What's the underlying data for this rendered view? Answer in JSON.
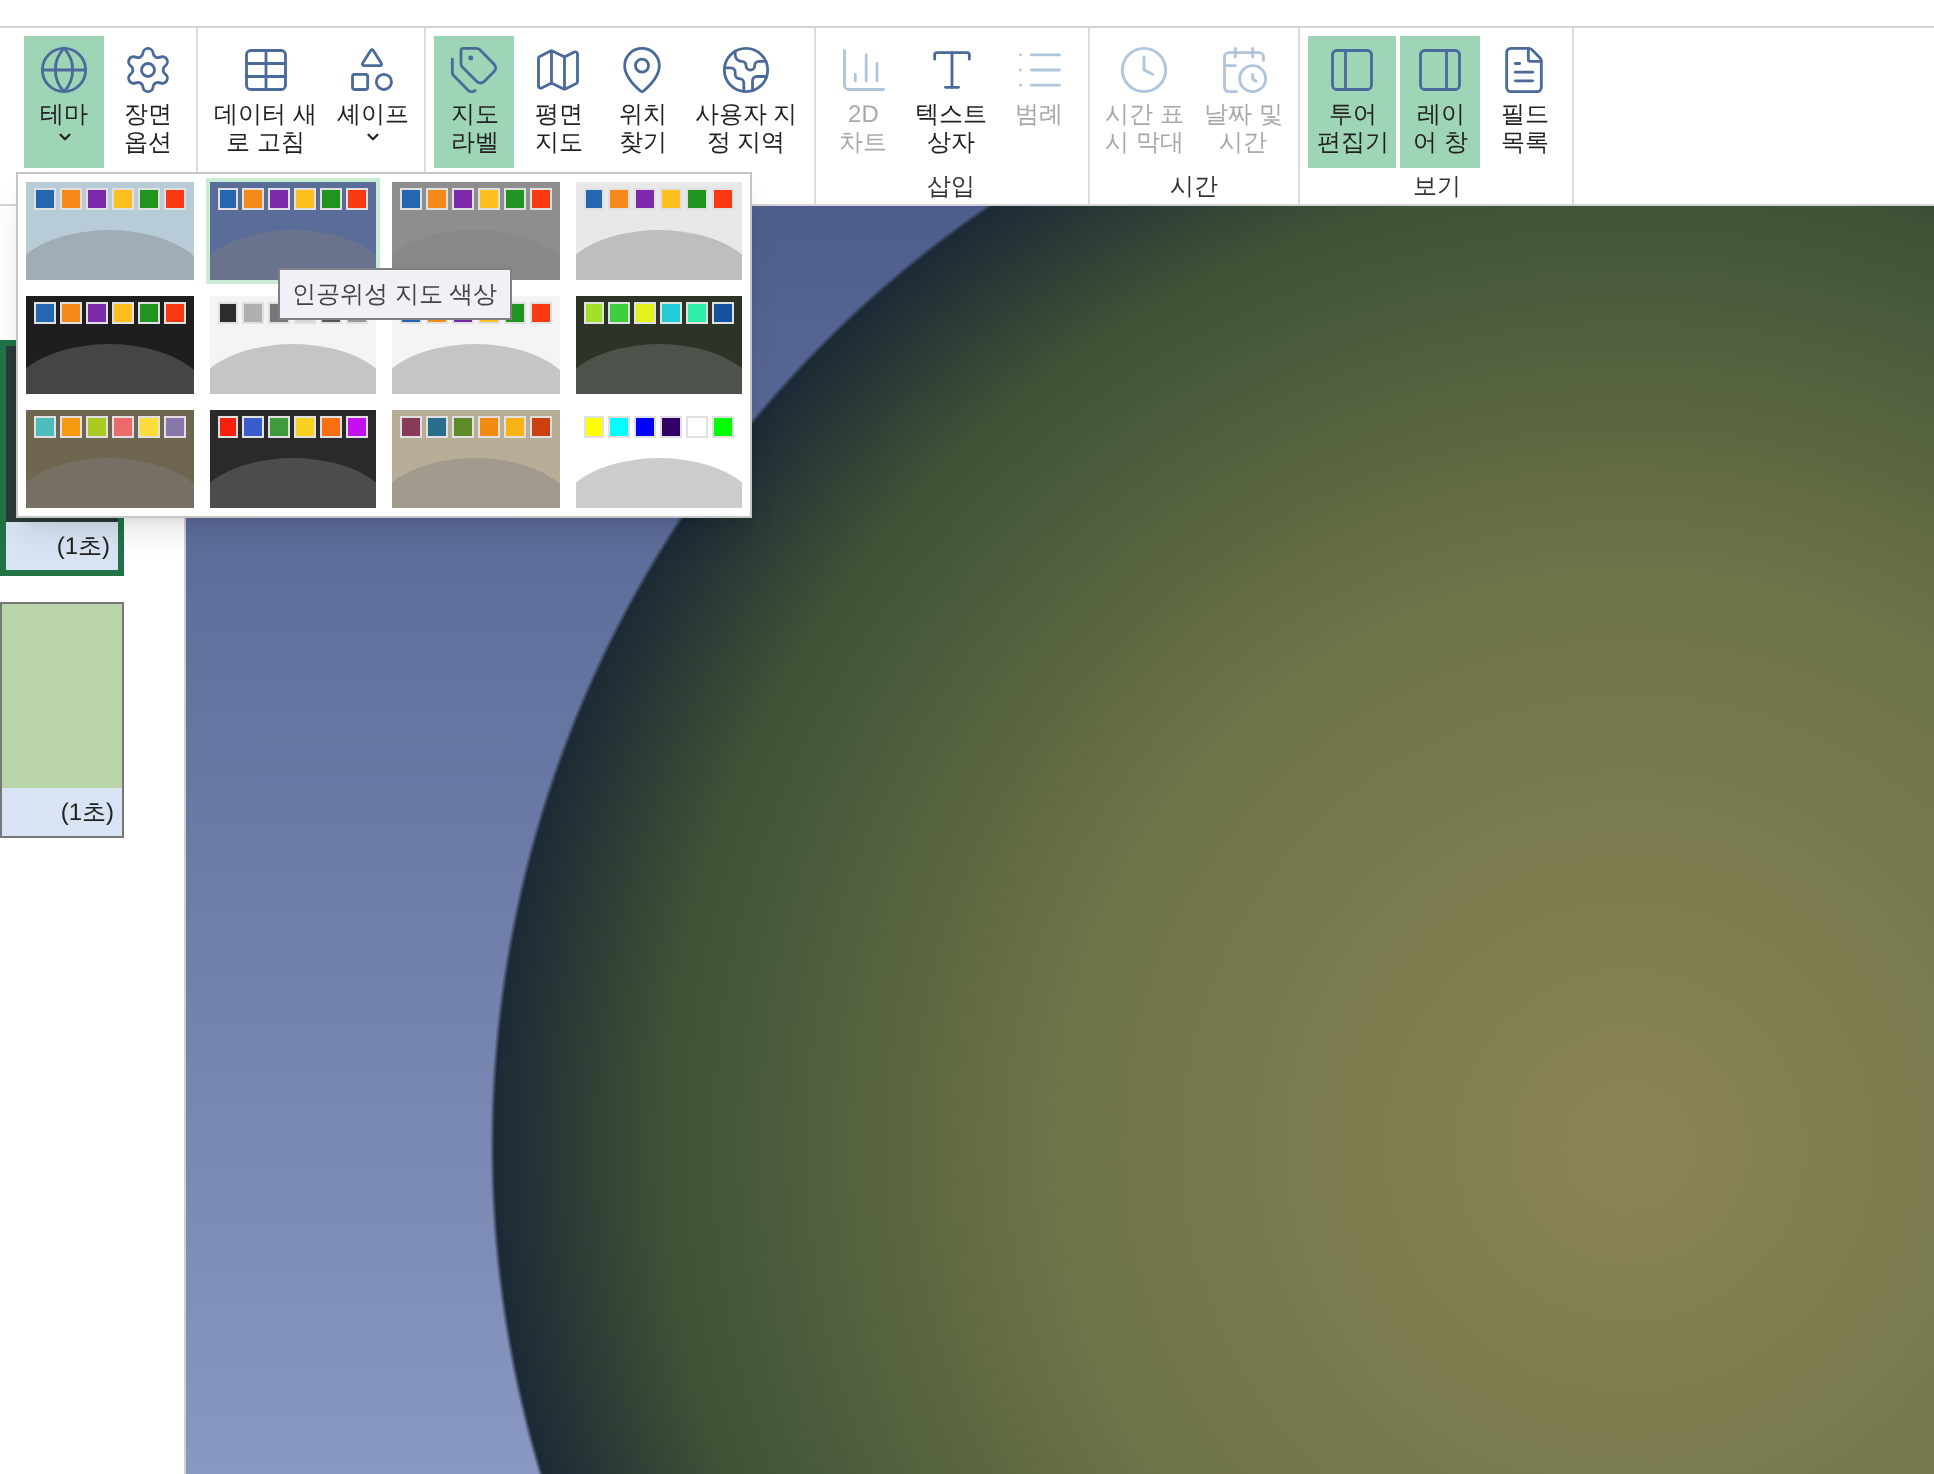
{
  "ribbon": {
    "groups": [
      {
        "buttons": [
          {
            "lines": [
              "테마"
            ],
            "on": true,
            "dropdown": true,
            "disabled": false
          },
          {
            "lines": [
              "장면",
              "옵션"
            ],
            "on": false,
            "dropdown": false,
            "disabled": false
          }
        ]
      },
      {
        "buttons": [
          {
            "lines": [
              "데이터 새",
              "로 고침"
            ],
            "on": false,
            "dropdown": false,
            "disabled": false
          },
          {
            "lines": [
              "셰이프"
            ],
            "on": false,
            "dropdown": true,
            "disabled": false
          }
        ]
      },
      {
        "buttons": [
          {
            "lines": [
              "지도",
              "라벨"
            ],
            "on": true,
            "dropdown": false,
            "disabled": false
          },
          {
            "lines": [
              "평면",
              "지도"
            ],
            "on": false,
            "dropdown": false,
            "disabled": false
          },
          {
            "lines": [
              "위치",
              "찾기"
            ],
            "on": false,
            "dropdown": false,
            "disabled": false
          },
          {
            "lines": [
              "사용자 지",
              "정 지역"
            ],
            "on": false,
            "dropdown": false,
            "disabled": false
          }
        ]
      },
      {
        "label": "삽입",
        "buttons": [
          {
            "lines": [
              "2D",
              "차트"
            ],
            "on": false,
            "dropdown": false,
            "disabled": true
          },
          {
            "lines": [
              "텍스트",
              "상자"
            ],
            "on": false,
            "dropdown": false,
            "disabled": false
          },
          {
            "lines": [
              "범례"
            ],
            "on": false,
            "dropdown": false,
            "disabled": true
          }
        ]
      },
      {
        "label": "시간",
        "buttons": [
          {
            "lines": [
              "시간 표",
              "시 막대"
            ],
            "on": false,
            "dropdown": false,
            "disabled": true
          },
          {
            "lines": [
              "날짜 및",
              "시간"
            ],
            "on": false,
            "dropdown": false,
            "disabled": true
          }
        ]
      },
      {
        "label": "보기",
        "buttons": [
          {
            "lines": [
              "투어",
              "편집기"
            ],
            "on": true,
            "dropdown": false,
            "disabled": false
          },
          {
            "lines": [
              "레이",
              "어 창"
            ],
            "on": true,
            "dropdown": false,
            "disabled": false
          },
          {
            "lines": [
              "필드",
              "목록"
            ],
            "on": false,
            "dropdown": false,
            "disabled": false
          }
        ]
      }
    ]
  },
  "theme_gallery": {
    "tooltip": "인공위성 지도 색상",
    "themes": [
      {
        "selected": false,
        "color": "#b8ccd8",
        "swatches": [
          {
            "color": "#2466b0"
          },
          {
            "color": "#f5891a"
          },
          {
            "color": "#7b2aab"
          },
          {
            "color": "#fdbf1e"
          },
          {
            "color": "#219321"
          },
          {
            "color": "#fb3a14"
          }
        ]
      },
      {
        "selected": true,
        "color": "#5a6c98",
        "swatches": [
          {
            "color": "#2466b0"
          },
          {
            "color": "#f5891a"
          },
          {
            "color": "#7b2aab"
          },
          {
            "color": "#fdbf1e"
          },
          {
            "color": "#219321"
          },
          {
            "color": "#fb3a14"
          }
        ]
      },
      {
        "selected": false,
        "color": "#8e8e8e",
        "swatches": [
          {
            "color": "#2466b0"
          },
          {
            "color": "#f5891a"
          },
          {
            "color": "#7b2aab"
          },
          {
            "color": "#fdbf1e"
          },
          {
            "color": "#219321"
          },
          {
            "color": "#fb3a14"
          }
        ]
      },
      {
        "selected": false,
        "color": "#e8e8e8",
        "swatches": [
          {
            "color": "#2466b0"
          },
          {
            "color": "#f5891a"
          },
          {
            "color": "#7b2aab"
          },
          {
            "color": "#fdbf1e"
          },
          {
            "color": "#219321"
          },
          {
            "color": "#fb3a14"
          }
        ]
      },
      {
        "selected": false,
        "color": "#1e1e1e",
        "swatches": [
          {
            "color": "#2466b0"
          },
          {
            "color": "#f5891a"
          },
          {
            "color": "#7b2aab"
          },
          {
            "color": "#fdbf1e"
          },
          {
            "color": "#219321"
          },
          {
            "color": "#fb3a14"
          }
        ]
      },
      {
        "selected": false,
        "color": "#f4f4f4",
        "swatches": [
          {
            "color": "#2c2c2c"
          },
          {
            "color": "#b0b0b0"
          },
          {
            "color": "#777777"
          },
          {
            "color": "#d4d4d4"
          },
          {
            "color": "#555555"
          },
          {
            "color": "#999999"
          }
        ]
      },
      {
        "selected": false,
        "color": "#f4f4f4",
        "swatches": [
          {
            "color": "#2466b0"
          },
          {
            "color": "#f5891a"
          },
          {
            "color": "#7b2aab"
          },
          {
            "color": "#fdbf1e"
          },
          {
            "color": "#219321"
          },
          {
            "color": "#fb3a14"
          }
        ]
      },
      {
        "selected": false,
        "color": "#2c3428",
        "swatches": [
          {
            "color": "#a2e02a"
          },
          {
            "color": "#3ecf3e"
          },
          {
            "color": "#e4f21c"
          },
          {
            "color": "#22ccd6"
          },
          {
            "color": "#2ef0a8"
          },
          {
            "color": "#1650a0"
          }
        ]
      },
      {
        "selected": false,
        "color": "#6e6650",
        "swatches": [
          {
            "color": "#4cbcbc"
          },
          {
            "color": "#f89a10"
          },
          {
            "color": "#aacc22"
          },
          {
            "color": "#ec6a6a"
          },
          {
            "color": "#fedc3a"
          },
          {
            "color": "#8877aa"
          }
        ]
      },
      {
        "selected": false,
        "color": "#2a2a2a",
        "swatches": [
          {
            "color": "#fa2010"
          },
          {
            "color": "#3a5ccc"
          },
          {
            "color": "#3e9a3e"
          },
          {
            "color": "#f8d020"
          },
          {
            "color": "#fa7010"
          },
          {
            "color": "#c410f0"
          }
        ]
      },
      {
        "selected": false,
        "color": "#b8ae98",
        "swatches": [
          {
            "color": "#883a58"
          },
          {
            "color": "#286e8a"
          },
          {
            "color": "#5e8a28"
          },
          {
            "color": "#f08a10"
          },
          {
            "color": "#fab214"
          },
          {
            "color": "#cc4010"
          }
        ]
      },
      {
        "selected": false,
        "color": "#ffffff",
        "swatches": [
          {
            "color": "#ffff00"
          },
          {
            "color": "#00ffff"
          },
          {
            "color": "#0000ff"
          },
          {
            "color": "#330066"
          },
          {
            "color": "#ffffff"
          },
          {
            "color": "#00ff00"
          }
        ]
      }
    ]
  },
  "scenes": [
    {
      "duration": "(1초)",
      "selected": true
    },
    {
      "duration": "(1초)",
      "selected": false
    }
  ]
}
